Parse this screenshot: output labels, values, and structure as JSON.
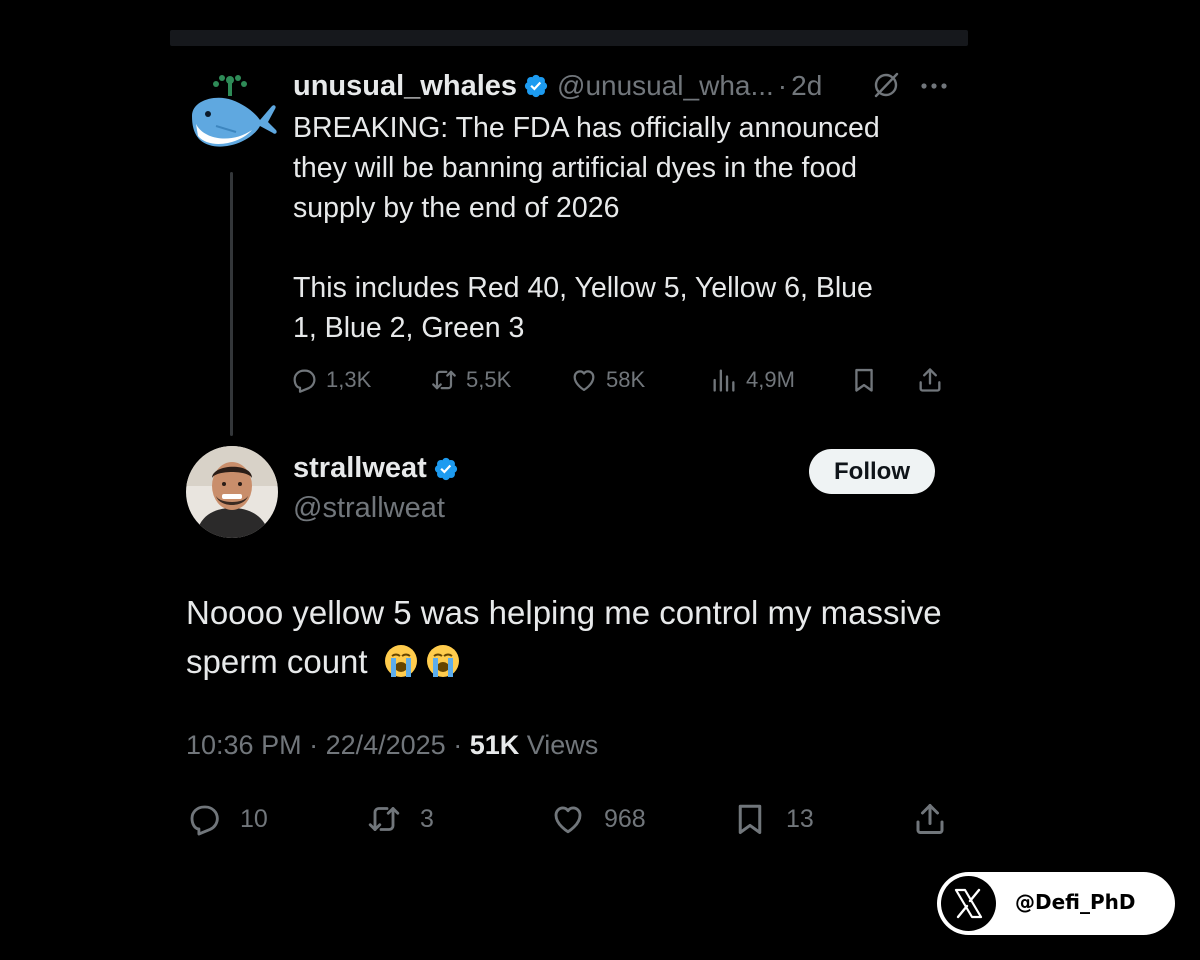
{
  "quoted_tweet": {
    "display_name": "unusual_whales",
    "handle": "@unusual_wha...",
    "separator": "·",
    "time": "2d",
    "text": "BREAKING: The FDA has officially announced\nthey will be banning artificial dyes in the food\nsupply by the end of 2026\n\nThis includes Red 40, Yellow 5, Yellow 6, Blue\n1, Blue 2, Green 3",
    "actions": {
      "replies": "1,3K",
      "reposts": "5,5K",
      "likes": "58K",
      "views": "4,9M"
    },
    "icons": [
      "whale-avatar-icon",
      "verified-badge-icon",
      "grok-icon",
      "more-icon",
      "reply-icon",
      "repost-icon",
      "like-icon",
      "views-icon",
      "bookmark-icon",
      "share-icon"
    ]
  },
  "main_tweet": {
    "display_name": "strallweat",
    "handle": "@strallweat",
    "follow_label": "Follow",
    "text": "Noooo yellow 5 was helping me control my massive sperm count",
    "emoji": [
      "loudly-crying-face",
      "loudly-crying-face"
    ],
    "meta": {
      "time": "10:36 PM",
      "sep1": " · ",
      "date": "22/4/2025",
      "sep2": " · ",
      "views_count": "51K",
      "views_label": " Views"
    },
    "actions": {
      "replies": "10",
      "reposts": "3",
      "likes": "968",
      "bookmarks": "13"
    }
  },
  "watermark": {
    "handle": "@Defi_PhD",
    "icon": "x-logo-icon"
  },
  "colors": {
    "background": "#000000",
    "text_primary": "#e7e9ea",
    "text_secondary": "#71767b",
    "verified_blue": "#1d9bf0",
    "thread_line": "#333639",
    "follow_button_bg": "#eff3f4"
  }
}
